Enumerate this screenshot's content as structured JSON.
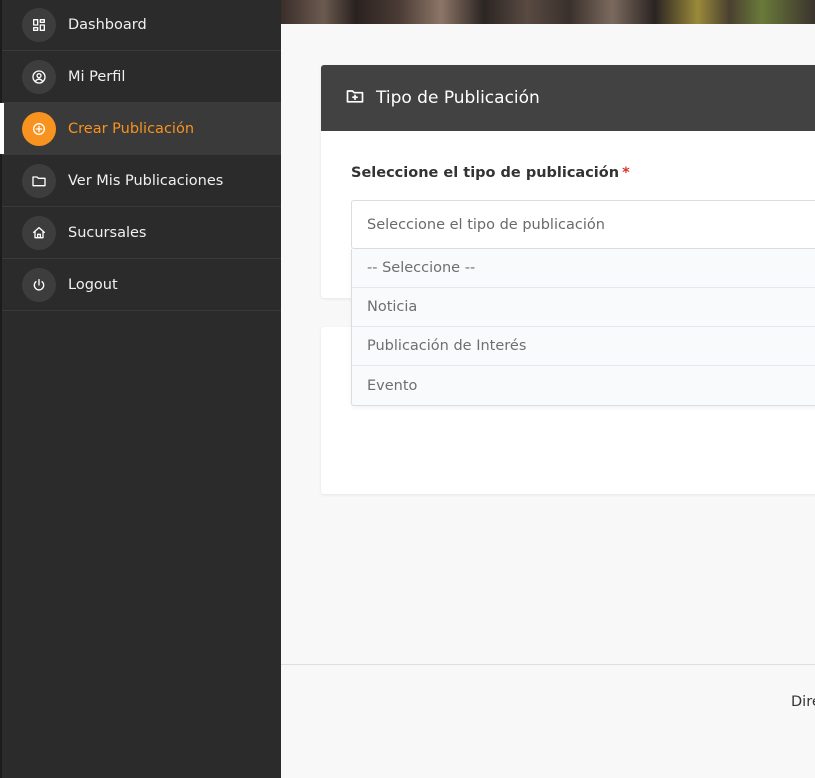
{
  "sidebar": {
    "items": [
      {
        "label": "Dashboard",
        "icon": "dashboard-icon",
        "active": false
      },
      {
        "label": "Mi Perfil",
        "icon": "user-circle-icon",
        "active": false
      },
      {
        "label": "Crear Publicación",
        "icon": "plus-circle-icon",
        "active": true
      },
      {
        "label": "Ver Mis Publicaciones",
        "icon": "folder-icon",
        "active": false
      },
      {
        "label": "Sucursales",
        "icon": "home-icon",
        "active": false
      },
      {
        "label": "Logout",
        "icon": "power-icon",
        "active": false
      }
    ]
  },
  "card": {
    "title": "Tipo de Publicación",
    "icon": "folder-plus-icon",
    "field_label": "Seleccione el tipo de publicación",
    "required_mark": "*",
    "select_value": "Seleccione el tipo de publicación"
  },
  "dropdown": {
    "options": [
      "-- Seleccione --",
      "Noticia",
      "Publicación de Interés",
      "Evento"
    ]
  },
  "footer": {
    "text": "Dire"
  },
  "colors": {
    "accent": "#f7931e",
    "sidebar_bg": "#2b2b2b",
    "header_bg": "#424242",
    "required": "#d9342b"
  }
}
